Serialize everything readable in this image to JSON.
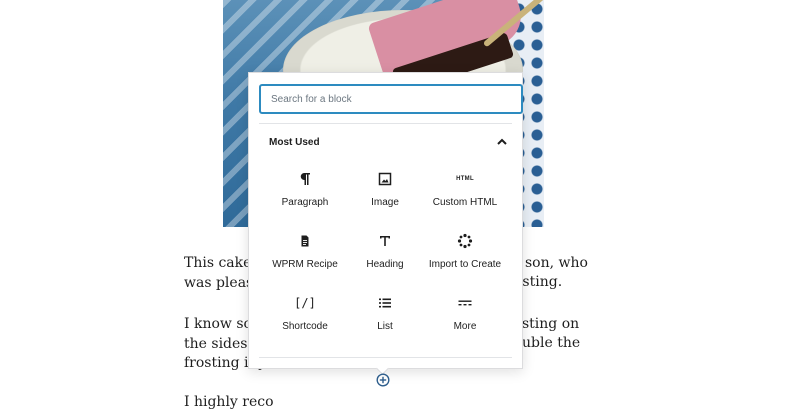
{
  "article": {
    "p1_line1": "This cake wa",
    "p1_line2": "was pleased",
    "p1_right1": "son, who",
    "p1_right2": "osting.",
    "p2_line1": "I know some",
    "p2_line2": "the sides —",
    "p2_line3": "frosting if yo",
    "p2_right1": "sting on",
    "p2_right2": "uble the",
    "p3_line1": "I highly reco"
  },
  "inserter": {
    "search_placeholder": "Search for a block",
    "section_title": "Most Used",
    "blocks": [
      {
        "label": "Paragraph",
        "icon": "paragraph-icon"
      },
      {
        "label": "Image",
        "icon": "image-icon"
      },
      {
        "label": "Custom HTML",
        "icon": "html-icon",
        "icon_text": "HTML"
      },
      {
        "label": "WPRM Recipe",
        "icon": "recipe-icon"
      },
      {
        "label": "Heading",
        "icon": "heading-icon"
      },
      {
        "label": "Import to Create",
        "icon": "import-icon"
      },
      {
        "label": "Shortcode",
        "icon": "shortcode-icon",
        "icon_text": "[/]"
      },
      {
        "label": "List",
        "icon": "list-icon"
      },
      {
        "label": "More",
        "icon": "more-icon"
      }
    ]
  },
  "colors": {
    "accent": "#2d8bc0",
    "text": "#1e1e1e",
    "muted": "#6c7781"
  }
}
